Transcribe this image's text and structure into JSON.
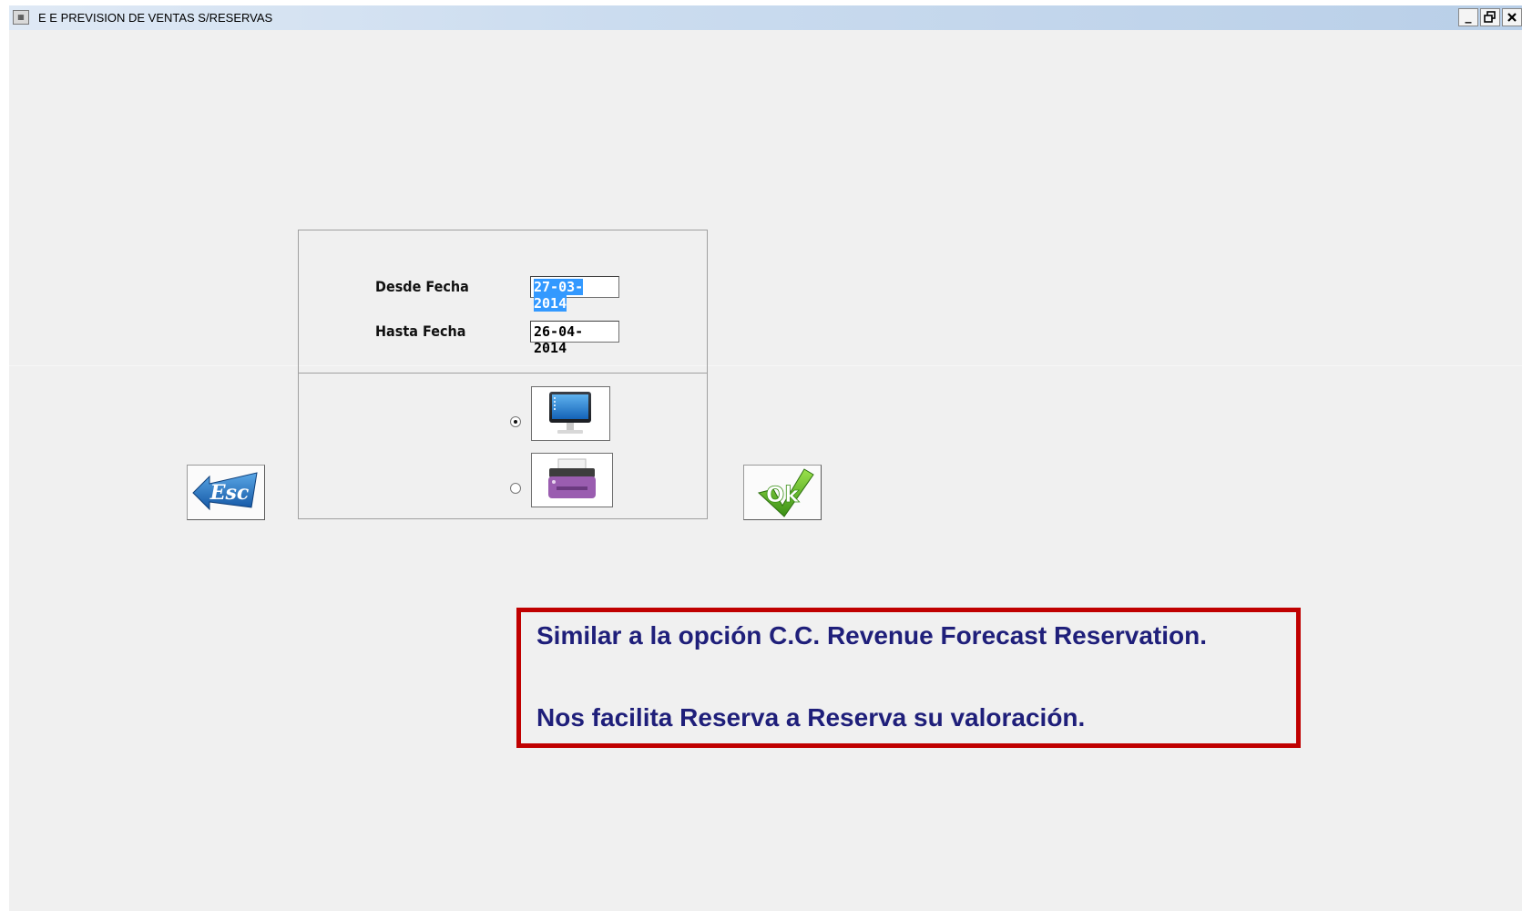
{
  "window": {
    "title": "E E PREVISION DE VENTAS S/RESERVAS",
    "controls": {
      "minimize": "_",
      "restore": "🗗",
      "close": "✕"
    }
  },
  "form": {
    "from_date": {
      "label": "Desde Fecha",
      "value": "27-03-2014"
    },
    "to_date": {
      "label": "Hasta Fecha",
      "value": "26-04-2014"
    },
    "output": {
      "options": [
        {
          "icon": "monitor-icon",
          "selected": true
        },
        {
          "icon": "printer-icon",
          "selected": false
        }
      ]
    }
  },
  "buttons": {
    "esc_label": "Esc",
    "ok_label": "Ok"
  },
  "note": {
    "line1": "Similar a la opción C.C. Revenue Forecast Reservation.",
    "line2": "Nos facilita Reserva a Reserva su valoración."
  },
  "colors": {
    "note_border": "#c00000",
    "note_text": "#1f1f7a",
    "selection": "#3399ff"
  }
}
